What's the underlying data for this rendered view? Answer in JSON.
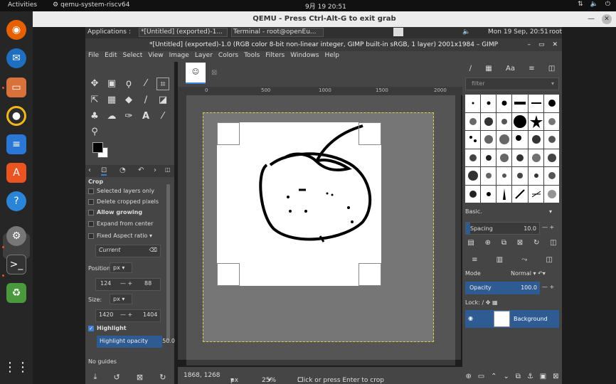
{
  "ubuntu_bar": {
    "activities": "Activities",
    "app_name": "qemu-system-riscv64",
    "clock": "9月 19 20:51"
  },
  "qemu": {
    "title": "QEMU - Press Ctrl-Alt-G to exit grab"
  },
  "guest_panel": {
    "applications": "Applications :",
    "task_gimp": "*[Untitled] (exported)-1...",
    "task_terminal": "Terminal - root@openEu...",
    "datetime": "Mon 19 Sep, 20:51",
    "user": "root"
  },
  "gimp": {
    "title": "*[Untitled] (exported)-1.0 (RGB color 8-bit non-linear integer, GIMP built-in sRGB, 1 layer) 2001x1984 – GIMP",
    "menu": [
      "File",
      "Edit",
      "Select",
      "View",
      "Image",
      "Layer",
      "Colors",
      "Tools",
      "Filters",
      "Windows",
      "Help"
    ],
    "tool_options": {
      "header": "Crop",
      "selected_layers_only": "Selected layers only",
      "delete_cropped": "Delete cropped pixels",
      "allow_growing": "Allow growing",
      "expand_from_center": "Expand from center",
      "fixed_label": "Fixed Aspect ratio",
      "current": "Current",
      "position_label": "Position:",
      "position_unit": "px",
      "position_x": "124",
      "position_y": "88",
      "size_label": "Size:",
      "size_unit": "px",
      "size_w": "1420",
      "size_h": "1404",
      "highlight": "Highlight",
      "highlight_opacity_label": "Highlight opacity",
      "highlight_opacity": "50.0",
      "guides": "No guides"
    },
    "ruler_ticks": [
      "0",
      "500",
      "1000",
      "1500",
      "2000"
    ],
    "status": {
      "coords": "1868, 1268",
      "unit": "px",
      "zoom": "25%",
      "message": "Click or press Enter to crop"
    },
    "right_dock": {
      "filter_placeholder": "filter",
      "brush_set": "Basic.",
      "spacing_label": "Spacing",
      "spacing_value": "10.0",
      "mode_label": "Mode",
      "mode_value": "Normal",
      "opacity_label": "Opacity",
      "opacity_value": "100.0",
      "lock_label": "Lock:",
      "layer_name": "Background"
    }
  },
  "colors": {
    "accent": "#2f5b93",
    "canvas_border": "#d6d34a"
  }
}
